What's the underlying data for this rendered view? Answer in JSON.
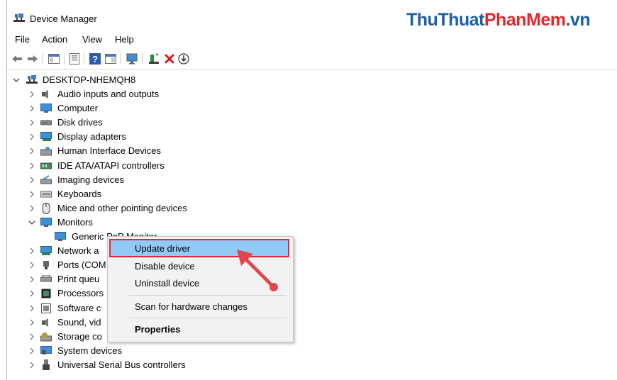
{
  "window": {
    "title": "Device Manager"
  },
  "watermark": {
    "part1": "Thu",
    "part2": "Thuat",
    "part3": "PhanMem",
    "part4": ".vn"
  },
  "menu": [
    "File",
    "Action",
    "View",
    "Help"
  ],
  "tree": {
    "root": "DESKTOP-NHEMQH8",
    "items": [
      {
        "label": "Audio inputs and outputs",
        "icon": "speaker-icon"
      },
      {
        "label": "Computer",
        "icon": "computer-icon"
      },
      {
        "label": "Disk drives",
        "icon": "disk-drive-icon"
      },
      {
        "label": "Display adapters",
        "icon": "display-adapter-icon"
      },
      {
        "label": "Human Interface Devices",
        "icon": "hid-icon"
      },
      {
        "label": "IDE ATA/ATAPI controllers",
        "icon": "ide-controller-icon"
      },
      {
        "label": "Imaging devices",
        "icon": "imaging-device-icon"
      },
      {
        "label": "Keyboards",
        "icon": "keyboard-icon"
      },
      {
        "label": "Mice and other pointing devices",
        "icon": "mouse-icon"
      },
      {
        "label": "Monitors",
        "icon": "monitor-icon",
        "expanded": true
      },
      {
        "label": "Generic PnP Monitor",
        "icon": "monitor-icon",
        "child": true
      },
      {
        "label": "Network a",
        "icon": "network-adapter-icon"
      },
      {
        "label": "Ports (COM",
        "icon": "port-icon"
      },
      {
        "label": "Print queu",
        "icon": "printer-icon"
      },
      {
        "label": "Processors",
        "icon": "processor-icon"
      },
      {
        "label": "Software c",
        "icon": "software-component-icon"
      },
      {
        "label": "Sound, vid",
        "icon": "sound-icon"
      },
      {
        "label": "Storage co",
        "icon": "storage-controller-icon"
      },
      {
        "label": "System devices",
        "icon": "system-devices-icon"
      },
      {
        "label": "Universal Serial Bus controllers",
        "icon": "usb-icon"
      }
    ]
  },
  "context_menu": {
    "update": "Update driver",
    "disable": "Disable device",
    "uninstall": "Uninstall device",
    "scan": "Scan for hardware changes",
    "properties": "Properties"
  },
  "colors": {
    "highlight": "#91c9f7",
    "annotation_red": "#e0263a",
    "folder_blue": "#1e78c8"
  }
}
